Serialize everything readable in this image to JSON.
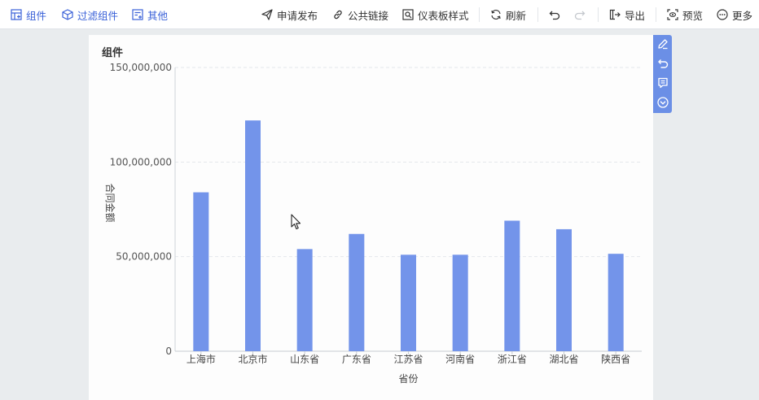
{
  "toolbar": {
    "left": [
      {
        "label": "组件",
        "icon": "add-widget-icon"
      },
      {
        "label": "过滤组件",
        "icon": "filter-cube-icon"
      },
      {
        "label": "其他",
        "icon": "add-other-icon"
      }
    ],
    "right": [
      {
        "label": "申请发布",
        "icon": "send-icon"
      },
      {
        "label": "公共链接",
        "icon": "link-icon"
      },
      {
        "label": "仪表板样式",
        "icon": "style-icon"
      },
      {
        "label": "刷新",
        "icon": "refresh-icon"
      },
      {
        "label": "导出",
        "icon": "export-icon"
      },
      {
        "label": "预览",
        "icon": "preview-icon"
      },
      {
        "label": "更多",
        "icon": "more-icon"
      }
    ],
    "colors": {
      "active": "#3a61d8",
      "text": "#333333"
    }
  },
  "widget": {
    "title": "组件"
  },
  "side_tools": [
    "edit-icon",
    "undo-icon",
    "comment-icon",
    "expand-down-icon"
  ],
  "chart_data": {
    "type": "bar",
    "categories": [
      "上海市",
      "北京市",
      "山东省",
      "广东省",
      "江苏省",
      "河南省",
      "浙江省",
      "湖北省",
      "陕西省"
    ],
    "values": [
      84000000,
      122000000,
      54000000,
      62000000,
      51000000,
      51000000,
      69000000,
      64500000,
      51500000
    ],
    "xlabel": "省份",
    "ylabel": "合同金额",
    "yticks": [
      "0",
      "50,000,000",
      "100,000,000",
      "150,000,000"
    ],
    "ylim": [
      0,
      150000000
    ],
    "grid": true,
    "bar_color": "#7394ea"
  }
}
